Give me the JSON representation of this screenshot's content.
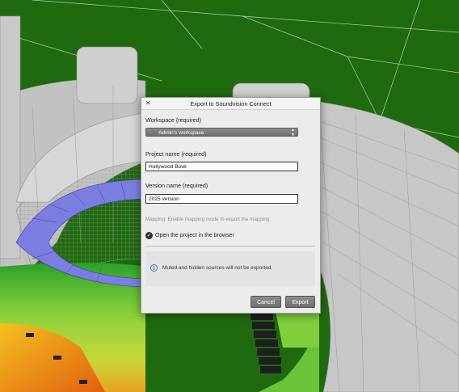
{
  "dialog": {
    "title": "Export to Soundvision Connect",
    "workspace_label": "Workspace (required)",
    "workspace_value": "Admin's workspace",
    "project_label": "Project name (required)",
    "project_value": "Hollywood Bowl",
    "version_label": "Version name (required)",
    "version_value": "2025 version",
    "mapping_hint": "Mapping: Enable mapping mode to export the mapping.",
    "open_browser_label": "Open the project in the browser",
    "info_message": "Muted and hidden sources will not be exported.",
    "cancel_label": "Cancel",
    "export_label": "Export"
  },
  "icons": {
    "close": "close-icon",
    "check": "checkmark-circle-icon",
    "info": "info-icon",
    "select_arrows": "updown-arrows-icon"
  },
  "colors": {
    "background_green": "#1f6a0f",
    "stage_gray": "#c9c9c9",
    "ring_blue": "#7b7ee0",
    "button_gray": "#7c7c7c",
    "info_blue": "#3f73b8"
  }
}
